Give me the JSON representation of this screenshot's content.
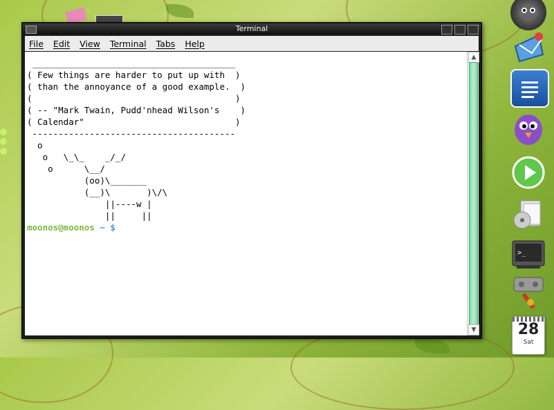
{
  "window": {
    "title": "Terminal"
  },
  "menubar": {
    "items": [
      "File",
      "Edit",
      "View",
      "Terminal",
      "Tabs",
      "Help"
    ]
  },
  "terminal": {
    "output": " _______________________________________\n( Few things are harder to put up with  )\n( than the annoyance of a good example.  )\n(                                       )\n( -- \"Mark Twain, Pudd'nhead Wilson's    )\n( Calendar\"                             )\n ---------------------------------------\n  o\n   o   \\_\\_    _/_/\n    o      \\__/\n           (oo)\\_______\n           (__)\\       )\\/\\\n               ||----w |\n               ||     ||",
    "prompt_user": "moonos@moonos",
    "prompt_path": " ~ $"
  },
  "dock": {
    "icons": [
      "gimp-icon",
      "email-icon",
      "writer-icon",
      "pidgin-icon",
      "media-player-icon",
      "archive-icon",
      "terminal-icon",
      "scanner-icon"
    ],
    "calendar": {
      "day": "28",
      "weekday": "Sat"
    }
  },
  "colors": {
    "prompt_user": "#7ab840",
    "prompt_path": "#5a8fd8",
    "scroll_thumb": "#7fd8a8"
  }
}
